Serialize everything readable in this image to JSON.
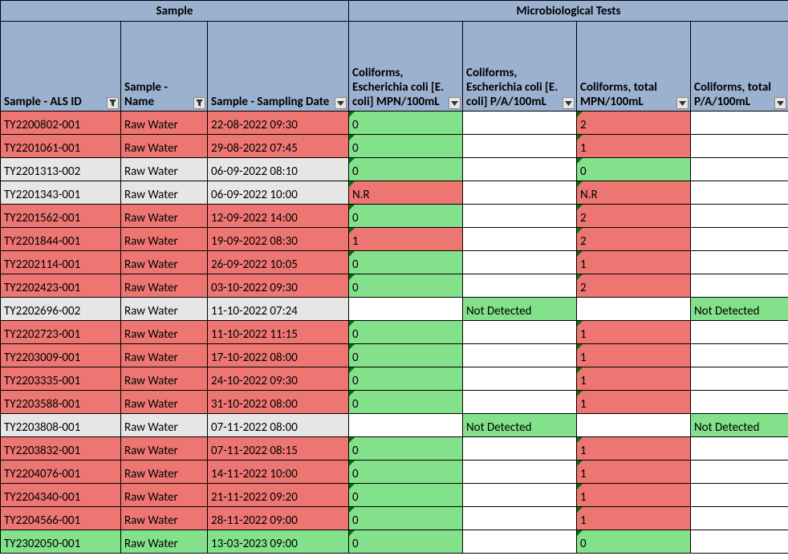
{
  "headers": {
    "group_sample": "Sample",
    "group_tests": "Microbiological Tests",
    "als_id": "Sample - ALS ID",
    "name": "Sample - Name",
    "date": "Sample - Sampling Date",
    "ecoli_mpn": "Coliforms, Escherichia coli [E. coli] MPN/100mL",
    "ecoli_pa": "Coliforms, Escherichia coli [E. coli] P/A/100mL",
    "total_mpn": "Coliforms, total MPN/100mL",
    "total_pa": "Coliforms, total P/A/100mL"
  },
  "rows": [
    {
      "id": "TY2200802-001",
      "name": "Raw Water",
      "date": "22-08-2022 09:30",
      "ecoli_mpn": "0",
      "ecoli_pa": "",
      "total_mpn": "2",
      "total_pa": "",
      "s": "red",
      "m1": "green",
      "m2": "red"
    },
    {
      "id": "TY2201061-001",
      "name": "Raw Water",
      "date": "29-08-2022 07:45",
      "ecoli_mpn": "0",
      "ecoli_pa": "",
      "total_mpn": "1",
      "total_pa": "",
      "s": "red",
      "m1": "green",
      "m2": "red"
    },
    {
      "id": "TY2201313-002",
      "name": "Raw Water",
      "date": "06-09-2022 08:10",
      "ecoli_mpn": "0",
      "ecoli_pa": "",
      "total_mpn": "0",
      "total_pa": "",
      "s": "gray",
      "m1": "green",
      "m2": "green"
    },
    {
      "id": "TY2201343-001",
      "name": "Raw Water",
      "date": "06-09-2022 10:00",
      "ecoli_mpn": "N.R",
      "ecoli_pa": "",
      "total_mpn": "N.R",
      "total_pa": "",
      "s": "gray",
      "m1": "red",
      "m2": "red"
    },
    {
      "id": "TY2201562-001",
      "name": "Raw Water",
      "date": "12-09-2022 14:00",
      "ecoli_mpn": "0",
      "ecoli_pa": "",
      "total_mpn": "2",
      "total_pa": "",
      "s": "red",
      "m1": "green",
      "m2": "red"
    },
    {
      "id": "TY2201844-001",
      "name": "Raw Water",
      "date": "19-09-2022 08:30",
      "ecoli_mpn": "1",
      "ecoli_pa": "",
      "total_mpn": "2",
      "total_pa": "",
      "s": "red",
      "m1": "red",
      "m2": "red"
    },
    {
      "id": "TY2202114-001",
      "name": "Raw Water",
      "date": "26-09-2022 10:05",
      "ecoli_mpn": "0",
      "ecoli_pa": "",
      "total_mpn": "1",
      "total_pa": "",
      "s": "red",
      "m1": "green",
      "m2": "red"
    },
    {
      "id": "TY2202423-001",
      "name": "Raw Water",
      "date": "03-10-2022 09:30",
      "ecoli_mpn": "0",
      "ecoli_pa": "",
      "total_mpn": "2",
      "total_pa": "",
      "s": "red",
      "m1": "green",
      "m2": "red"
    },
    {
      "id": "TY2202696-002",
      "name": "Raw Water",
      "date": "11-10-2022 07:24",
      "ecoli_mpn": "",
      "ecoli_pa": "Not Detected",
      "total_mpn": "",
      "total_pa": "Not Detected",
      "s": "gray",
      "p1": "green",
      "p2": "green"
    },
    {
      "id": "TY2202723-001",
      "name": "Raw Water",
      "date": "11-10-2022 11:15",
      "ecoli_mpn": "0",
      "ecoli_pa": "",
      "total_mpn": "1",
      "total_pa": "",
      "s": "red",
      "m1": "green",
      "m2": "red"
    },
    {
      "id": "TY2203009-001",
      "name": "Raw Water",
      "date": "17-10-2022 08:00",
      "ecoli_mpn": "0",
      "ecoli_pa": "",
      "total_mpn": "1",
      "total_pa": "",
      "s": "red",
      "m1": "green",
      "m2": "red"
    },
    {
      "id": "TY2203335-001",
      "name": "Raw Water",
      "date": "24-10-2022 09:30",
      "ecoli_mpn": "0",
      "ecoli_pa": "",
      "total_mpn": "1",
      "total_pa": "",
      "s": "red",
      "m1": "green",
      "m2": "red"
    },
    {
      "id": "TY2203588-001",
      "name": "Raw Water",
      "date": "31-10-2022 08:00",
      "ecoli_mpn": "0",
      "ecoli_pa": "",
      "total_mpn": "1",
      "total_pa": "",
      "s": "red",
      "m1": "green",
      "m2": "red"
    },
    {
      "id": "TY2203808-001",
      "name": "Raw Water",
      "date": "07-11-2022 08:00",
      "ecoli_mpn": "",
      "ecoli_pa": "Not Detected",
      "total_mpn": "",
      "total_pa": "Not Detected",
      "s": "gray",
      "p1": "green",
      "p2": "green"
    },
    {
      "id": "TY2203832-001",
      "name": "Raw Water",
      "date": "07-11-2022 08:15",
      "ecoli_mpn": "0",
      "ecoli_pa": "",
      "total_mpn": "1",
      "total_pa": "",
      "s": "red",
      "m1": "green",
      "m2": "red"
    },
    {
      "id": "TY2204076-001",
      "name": "Raw Water",
      "date": "14-11-2022 10:00",
      "ecoli_mpn": "0",
      "ecoli_pa": "",
      "total_mpn": "1",
      "total_pa": "",
      "s": "red",
      "m1": "green",
      "m2": "red"
    },
    {
      "id": "TY2204340-001",
      "name": "Raw Water",
      "date": "21-11-2022 09:20",
      "ecoli_mpn": "0",
      "ecoli_pa": "",
      "total_mpn": "1",
      "total_pa": "",
      "s": "red",
      "m1": "green",
      "m2": "red"
    },
    {
      "id": "TY2204566-001",
      "name": "Raw Water",
      "date": "28-11-2022 09:00",
      "ecoli_mpn": "0",
      "ecoli_pa": "",
      "total_mpn": "1",
      "total_pa": "",
      "s": "red",
      "m1": "green",
      "m2": "red"
    },
    {
      "id": "TY2302050-001",
      "name": "Raw Water",
      "date": "13-03-2023 09:00",
      "ecoli_mpn": "0",
      "ecoli_pa": "",
      "total_mpn": "0",
      "total_pa": "",
      "s": "green",
      "m1": "green",
      "m2": "green"
    }
  ]
}
